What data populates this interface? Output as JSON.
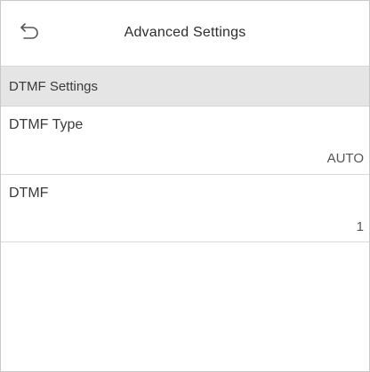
{
  "header": {
    "title": "Advanced Settings",
    "back_icon": "back-arrow-icon"
  },
  "section": {
    "title": "DTMF Settings"
  },
  "rows": [
    {
      "label": "DTMF Type",
      "value": "AUTO"
    },
    {
      "label": "DTMF",
      "value": "1"
    }
  ],
  "colors": {
    "section_background": "#e5e5e5",
    "divider": "#d9d9d9",
    "text": "#3a3a3a"
  }
}
